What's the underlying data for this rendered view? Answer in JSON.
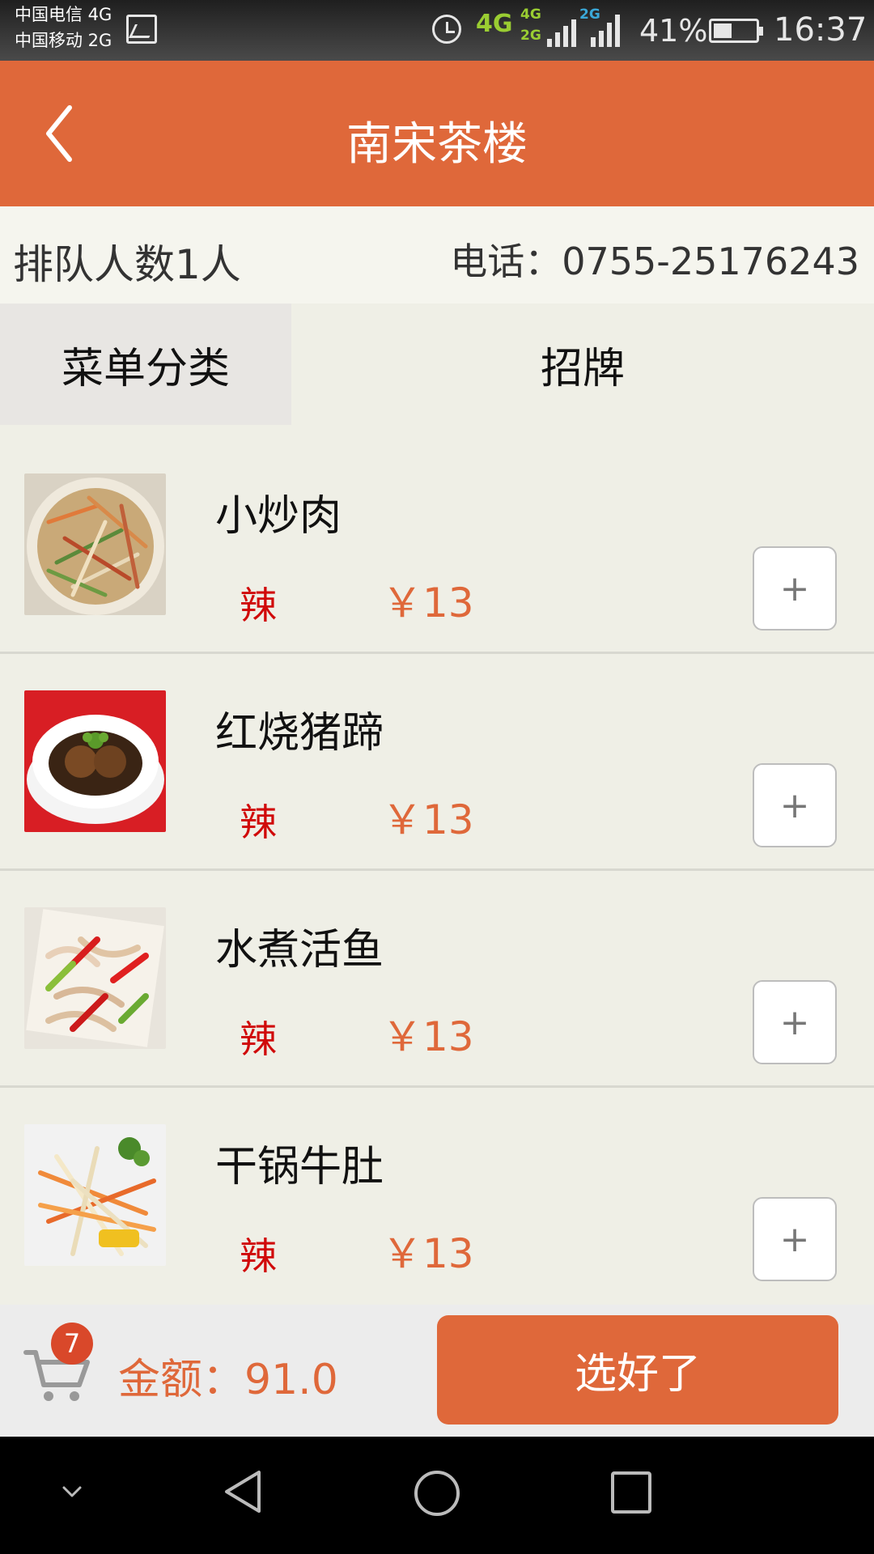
{
  "status_bar": {
    "carrier1": "中国电信 4G",
    "carrier2": "中国移动 2G",
    "net_main": "4G",
    "net_sub1": "4G",
    "net_sub2": "2G",
    "net_sub3": "2G",
    "battery": "41%",
    "time": "16:37"
  },
  "header": {
    "title": "南宋茶楼"
  },
  "info": {
    "queue": "排队人数1人",
    "phone": "电话：0755-25176243"
  },
  "tabs": [
    {
      "label": "菜单分类"
    },
    {
      "label": "招牌"
    }
  ],
  "dishes": [
    {
      "name": "小炒肉",
      "tag": "辣",
      "price": "￥13",
      "add": "+"
    },
    {
      "name": "红烧猪蹄",
      "tag": "辣",
      "price": "￥13",
      "add": "+"
    },
    {
      "name": "水煮活鱼",
      "tag": "辣",
      "price": "￥13",
      "add": "+"
    },
    {
      "name": "干锅牛肚",
      "tag": "辣",
      "price": "￥13",
      "add": "+"
    }
  ],
  "cart": {
    "count": "7",
    "amount": "金额：91.0",
    "confirm": "选好了"
  },
  "colors": {
    "accent": "#df683a",
    "tag": "#d00a0a",
    "background": "#efefe6"
  },
  "icons": [
    "gallery-icon",
    "alarm-icon",
    "signal-icon",
    "battery-icon",
    "back-icon",
    "cart-icon",
    "nav-collapse-icon",
    "nav-back-icon",
    "nav-home-icon",
    "nav-recents-icon"
  ]
}
